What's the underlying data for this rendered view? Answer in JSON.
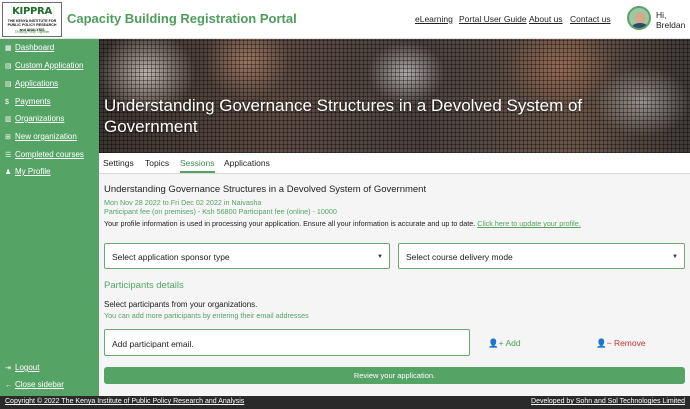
{
  "header": {
    "logo_text": "KIPPRA",
    "logo_subtitle": "THE KENYA INSTITUTE FOR PUBLIC POLICY RESEARCH and ANALYSIS",
    "logo_tagline": "Thinking Policy Together",
    "portal_title": "Capacity Building Registration Portal",
    "nav": [
      "eLearning",
      "Portal User Guide",
      "About us",
      "Contact us"
    ],
    "greeting": "Hi,",
    "user_name": "Breldan"
  },
  "sidebar": {
    "items": [
      {
        "label": "Dashboard",
        "icon": "dashboard-icon"
      },
      {
        "label": "Custom Application",
        "icon": "document-icon"
      },
      {
        "label": "Applications",
        "icon": "document-icon"
      },
      {
        "label": "Payments",
        "icon": "dollar-icon"
      },
      {
        "label": "Organizations",
        "icon": "building-icon"
      },
      {
        "label": "New organization",
        "icon": "plus-icon"
      },
      {
        "label": "Completed courses",
        "icon": "list-icon"
      },
      {
        "label": "My Profile",
        "icon": "user-icon"
      }
    ],
    "bottom_items": [
      {
        "label": "Logout",
        "icon": "logout-icon"
      },
      {
        "label": "Close sidebar",
        "icon": "arrow-left-icon"
      }
    ]
  },
  "banner": {
    "title": "Understanding Governance Structures in a Devolved System of Government"
  },
  "tabs": [
    {
      "label": "Settings",
      "active": false
    },
    {
      "label": "Topics",
      "active": false
    },
    {
      "label": "Sessions",
      "active": true
    },
    {
      "label": "Applications",
      "active": false
    }
  ],
  "content": {
    "course_title": "Understanding Governance Structures in a Devolved System of Government",
    "dates": "Mon Nov 28 2022 to Fri Dec 02 2022 in Naivasha",
    "fees": "Participant fee (on premises) - Ksh 56800 Participant fee (online) - 10000",
    "info_text": "Your profile information is used in processing your application. Ensure all your information is accurate and up to date.",
    "info_link": "Click here to update your profile.",
    "sponsor_select": "Select application sponsor type",
    "delivery_select": "Select course delivery mode",
    "participants_heading": "Participants details",
    "participants_instruction": "Select participants from your organizations.",
    "participants_hint": "You can add more participants by entering their email addresses",
    "email_placeholder": "Add participant email.",
    "add_label": "Add",
    "remove_label": "Remove",
    "review_label": "Review your application."
  },
  "footer": {
    "copyright": "Copyright © 2022 The Kenya Institute of Public Policy Research and Analysis",
    "developer": "Developed by Sohn and Sol Technologies Limited"
  },
  "colors": {
    "primary_green": "#56a366",
    "remove_red": "#cc3333",
    "footer_bg": "#2a2a2a"
  }
}
